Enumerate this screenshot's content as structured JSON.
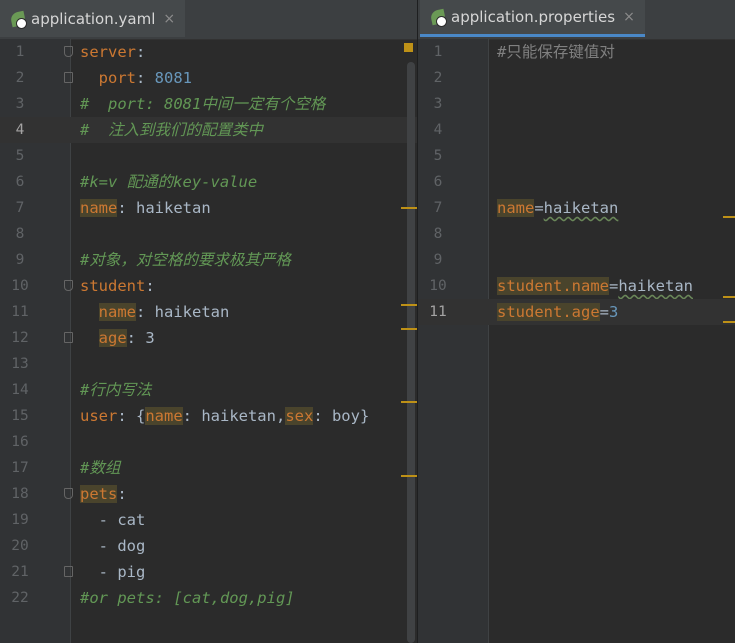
{
  "left_editor": {
    "tab_label": "application.yaml",
    "close_glyph": "×",
    "lines": [
      {
        "num": "1",
        "tokens": [
          {
            "t": "server",
            "c": "k"
          },
          {
            "t": ":"
          }
        ],
        "fold": "down"
      },
      {
        "num": "2",
        "tokens": [
          {
            "t": "  "
          },
          {
            "t": "port",
            "c": "k"
          },
          {
            "t": ": "
          },
          {
            "t": "8081",
            "c": "n"
          }
        ],
        "fold": "up"
      },
      {
        "num": "3",
        "tokens": [
          {
            "t": "#  port: 8081中间一定有个空格",
            "c": "c"
          }
        ]
      },
      {
        "num": "4",
        "tokens": [
          {
            "t": "#  注入到我们的配置类中",
            "c": "c"
          }
        ],
        "current": true
      },
      {
        "num": "5",
        "tokens": []
      },
      {
        "num": "6",
        "tokens": [
          {
            "t": "#k=v 配通的key-value",
            "c": "c"
          }
        ]
      },
      {
        "num": "7",
        "tokens": [
          {
            "t": "name",
            "c": "k hl"
          },
          {
            "t": ": haiketan"
          }
        ]
      },
      {
        "num": "8",
        "tokens": []
      },
      {
        "num": "9",
        "tokens": [
          {
            "t": "#对象，对空格的要求极其严格",
            "c": "c"
          }
        ]
      },
      {
        "num": "10",
        "tokens": [
          {
            "t": "student",
            "c": "k"
          },
          {
            "t": ":"
          }
        ],
        "fold": "down"
      },
      {
        "num": "11",
        "tokens": [
          {
            "t": "  "
          },
          {
            "t": "name",
            "c": "k hl"
          },
          {
            "t": ": haiketan"
          }
        ]
      },
      {
        "num": "12",
        "tokens": [
          {
            "t": "  "
          },
          {
            "t": "age",
            "c": "k hl"
          },
          {
            "t": ": 3"
          }
        ],
        "fold": "up"
      },
      {
        "num": "13",
        "tokens": []
      },
      {
        "num": "14",
        "tokens": [
          {
            "t": "#行内写法",
            "c": "c"
          }
        ]
      },
      {
        "num": "15",
        "tokens": [
          {
            "t": "user",
            "c": "k"
          },
          {
            "t": ": {"
          },
          {
            "t": "name",
            "c": "k hl"
          },
          {
            "t": ": haiketan,"
          },
          {
            "t": "sex",
            "c": "k hl"
          },
          {
            "t": ": boy}"
          }
        ]
      },
      {
        "num": "16",
        "tokens": []
      },
      {
        "num": "17",
        "tokens": [
          {
            "t": "#数组",
            "c": "c"
          }
        ]
      },
      {
        "num": "18",
        "tokens": [
          {
            "t": "pets",
            "c": "k hl"
          },
          {
            "t": ":"
          }
        ],
        "fold": "down"
      },
      {
        "num": "19",
        "tokens": [
          {
            "t": "  - cat"
          }
        ]
      },
      {
        "num": "20",
        "tokens": [
          {
            "t": "  - dog"
          }
        ]
      },
      {
        "num": "21",
        "tokens": [
          {
            "t": "  - pig"
          }
        ],
        "fold": "up"
      },
      {
        "num": "22",
        "tokens": [
          {
            "t": "#or pets: [cat,dog,pig]",
            "c": "c"
          }
        ]
      }
    ]
  },
  "right_editor": {
    "tab_label": "application.properties",
    "close_glyph": "×",
    "lines": [
      {
        "num": "1",
        "tokens": [
          {
            "t": "#只能保存键值对",
            "c": "gray"
          }
        ]
      },
      {
        "num": "2",
        "tokens": []
      },
      {
        "num": "3",
        "tokens": []
      },
      {
        "num": "4",
        "tokens": []
      },
      {
        "num": "5",
        "tokens": []
      },
      {
        "num": "6",
        "tokens": []
      },
      {
        "num": "7",
        "tokens": [
          {
            "t": "name",
            "c": "k hl"
          },
          {
            "t": "="
          },
          {
            "t": "haiketan",
            "c": "w"
          }
        ]
      },
      {
        "num": "8",
        "tokens": []
      },
      {
        "num": "9",
        "tokens": []
      },
      {
        "num": "10",
        "tokens": [
          {
            "t": "student.name",
            "c": "k hl"
          },
          {
            "t": "="
          },
          {
            "t": "haiketan",
            "c": "w"
          }
        ]
      },
      {
        "num": "11",
        "tokens": [
          {
            "t": "student.age",
            "c": "k hl"
          },
          {
            "t": "="
          },
          {
            "t": "3",
            "c": "n"
          }
        ],
        "current": true
      }
    ]
  },
  "colors": {
    "background": "#2b2b2b",
    "keyword": "#cc7832",
    "number": "#6897bb",
    "comment": "#629755",
    "text": "#a9b7c6",
    "warning_marker": "#be9117",
    "active_tab_underline": "#4a88c7"
  },
  "icons": {
    "tab_icon": "spring-leaf-gear-icon",
    "close": "close-icon",
    "fold": "fold-marker-icon"
  }
}
